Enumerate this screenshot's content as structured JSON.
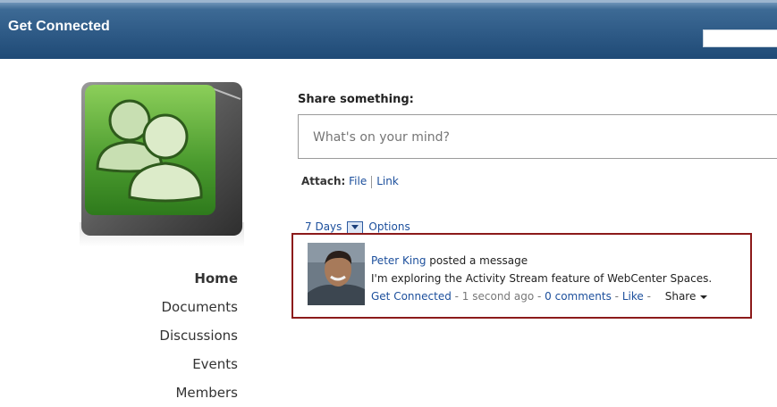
{
  "header": {
    "title": "Get Connected"
  },
  "nav": {
    "items": [
      "Home",
      "Documents",
      "Discussions",
      "Events",
      "Members"
    ]
  },
  "share": {
    "label": "Share something:",
    "placeholder": "What's on your mind?"
  },
  "attach": {
    "label": "Attach:",
    "file": "File",
    "link": "Link"
  },
  "filter": {
    "range": "7 Days",
    "options": "Options"
  },
  "activity": {
    "author": "Peter King",
    "action": " posted a message",
    "message": "I'm exploring the Activity Stream feature of WebCenter Spaces.",
    "space": "Get Connected",
    "time": "1 second ago",
    "comments": "0 comments",
    "like": "Like",
    "share": "Share"
  },
  "colors": {
    "header": "#2e5a86",
    "link": "#1c4f9c",
    "highlight_border": "#8c1a1a",
    "logo_green": "#4a9a2e"
  }
}
